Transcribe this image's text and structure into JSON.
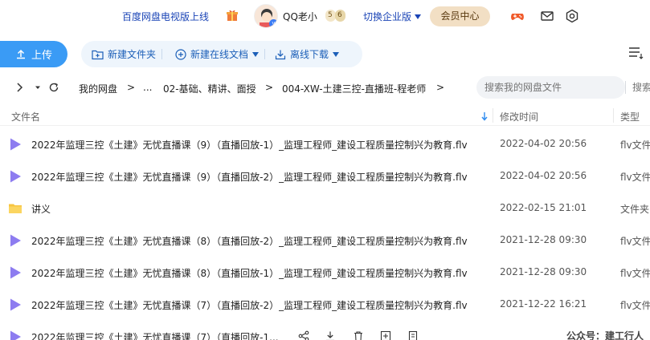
{
  "header": {
    "promo_text": "百度网盘电视版上线",
    "username": "QQ老小",
    "badge_level": "5",
    "badge_level2": "6",
    "switch_enterprise": "切换企业版",
    "vip_center": "会员中心",
    "icons": [
      "gift-icon",
      "game-icon",
      "mail-icon",
      "settings-icon"
    ]
  },
  "toolbar": {
    "upload": "上传",
    "new_folder": "新建文件夹",
    "new_online_doc": "新建在线文档",
    "offline_download": "离线下载",
    "view_icon": "list-view-icon"
  },
  "nav": {
    "breadcrumb": [
      "我的网盘",
      ">",
      "...",
      "02-基础、精讲、面授",
      ">",
      "004-XW-土建三控-直播班-程老师",
      ">"
    ],
    "search_placeholder": "搜索我的网盘文件",
    "search2_placeholder": "搜索"
  },
  "table": {
    "columns": {
      "name": "文件名",
      "modified": "修改时间",
      "type": "类型"
    },
    "rows": [
      {
        "name": "2022年监理三控《土建》无忧直播课（9）（直播回放-1）_监理工程师_建设工程质量控制兴为教育.flv",
        "date": "2022-04-02 20:56",
        "type": "flv文件",
        "kind": "video"
      },
      {
        "name": "2022年监理三控《土建》无忧直播课（9）（直播回放-2）_监理工程师_建设工程质量控制兴为教育.flv",
        "date": "2022-04-02 20:56",
        "type": "flv文件",
        "kind": "video"
      },
      {
        "name": "讲义",
        "date": "2022-02-15 21:01",
        "type": "文件夹",
        "kind": "folder"
      },
      {
        "name": "2022年监理三控《土建》无忧直播课（8）（直播回放-2）_监理工程师_建设工程质量控制兴为教育.flv",
        "date": "2021-12-28 09:30",
        "type": "flv文件",
        "kind": "video"
      },
      {
        "name": "2022年监理三控《土建》无忧直播课（8）（直播回放-1）_监理工程师_建设工程质量控制兴为教育.flv",
        "date": "2021-12-28 09:30",
        "type": "flv文件",
        "kind": "video"
      },
      {
        "name": "2022年监理三控《土建》无忧直播课（7）（直播回放-2）_监理工程师_建设工程质量控制兴为教育.flv",
        "date": "2021-12-22 16:21",
        "type": "flv文件",
        "kind": "video"
      },
      {
        "name": "2022年监理三控《土建》无忧直播课（7）（直播回放-1...",
        "date": "",
        "type": "",
        "kind": "video"
      }
    ]
  },
  "watermark": "公众号：建工行人"
}
